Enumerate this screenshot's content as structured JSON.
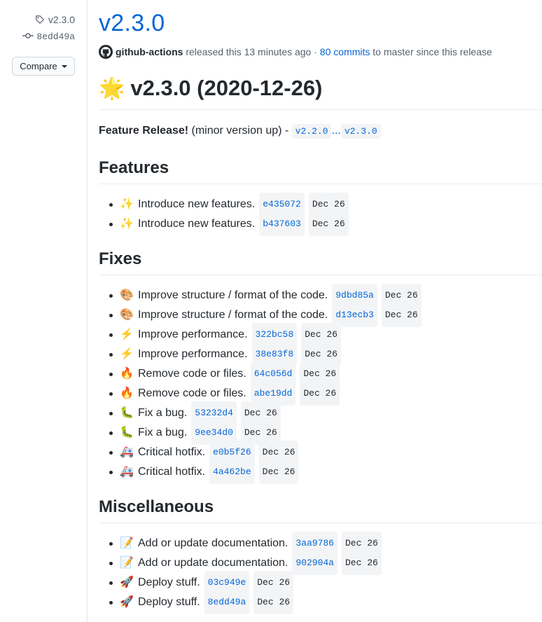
{
  "sidebar": {
    "tag": "v2.3.0",
    "commit": "8edd49a",
    "compare": "Compare"
  },
  "release": {
    "title": "v2.3.0",
    "author": "github-actions",
    "released_text": "released this 13 minutes ago ·",
    "commits_link": "80 commits",
    "commits_tail": "to master since this release",
    "heading": "v2.3.0 (2020-12-26)",
    "heading_emoji": "🌟",
    "lead_bold": "Feature Release!",
    "lead_text": "(minor version up) -",
    "from_version": "v2.2.0",
    "range_sep": "...",
    "to_version": "v2.3.0"
  },
  "sections": [
    {
      "title": "Features",
      "items": [
        {
          "emoji": "✨",
          "text": "Introduce new features.",
          "sha": "e435072",
          "date": "Dec 26"
        },
        {
          "emoji": "✨",
          "text": "Introduce new features.",
          "sha": "b437603",
          "date": "Dec 26"
        }
      ]
    },
    {
      "title": "Fixes",
      "items": [
        {
          "emoji": "🎨",
          "text": "Improve structure / format of the code.",
          "sha": "9dbd85a",
          "date": "Dec 26"
        },
        {
          "emoji": "🎨",
          "text": "Improve structure / format of the code.",
          "sha": "d13ecb3",
          "date": "Dec 26"
        },
        {
          "emoji": "⚡",
          "text": "Improve performance.",
          "sha": "322bc58",
          "date": "Dec 26"
        },
        {
          "emoji": "⚡",
          "text": "Improve performance.",
          "sha": "38e83f8",
          "date": "Dec 26"
        },
        {
          "emoji": "🔥",
          "text": "Remove code or files.",
          "sha": "64c056d",
          "date": "Dec 26"
        },
        {
          "emoji": "🔥",
          "text": "Remove code or files.",
          "sha": "abe19dd",
          "date": "Dec 26"
        },
        {
          "emoji": "🐛",
          "text": "Fix a bug.",
          "sha": "53232d4",
          "date": "Dec 26"
        },
        {
          "emoji": "🐛",
          "text": "Fix a bug.",
          "sha": "9ee34d0",
          "date": "Dec 26"
        },
        {
          "emoji": "🚑",
          "text": "Critical hotfix.",
          "sha": "e0b5f26",
          "date": "Dec 26"
        },
        {
          "emoji": "🚑",
          "text": "Critical hotfix.",
          "sha": "4a462be",
          "date": "Dec 26"
        }
      ]
    },
    {
      "title": "Miscellaneous",
      "items": [
        {
          "emoji": "📝",
          "text": "Add or update documentation.",
          "sha": "3aa9786",
          "date": "Dec 26"
        },
        {
          "emoji": "📝",
          "text": "Add or update documentation.",
          "sha": "902904a",
          "date": "Dec 26"
        },
        {
          "emoji": "🚀",
          "text": "Deploy stuff.",
          "sha": "03c949e",
          "date": "Dec 26"
        },
        {
          "emoji": "🚀",
          "text": "Deploy stuff.",
          "sha": "8edd49a",
          "date": "Dec 26"
        }
      ]
    }
  ],
  "colors": {
    "link": "#0366d6",
    "text": "#24292e",
    "muted": "#586069",
    "code_bg": "#f3f4f6"
  }
}
